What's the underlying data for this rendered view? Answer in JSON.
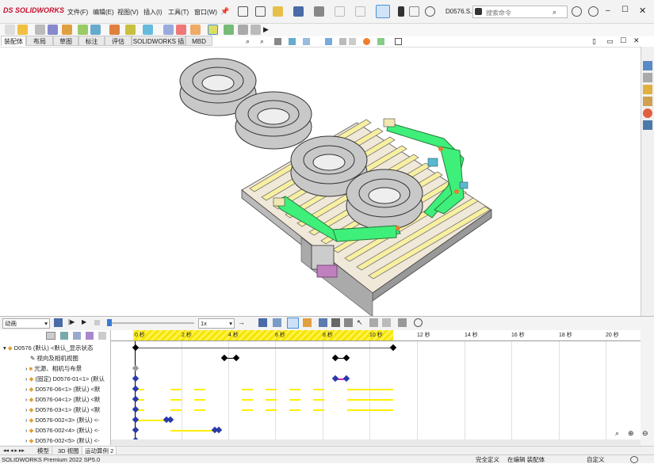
{
  "app": {
    "logo": "SOLIDWORKS",
    "doc_title": "D0576.S..."
  },
  "menu": [
    "文件(F)",
    "编辑(E)",
    "视图(V)",
    "插入(I)",
    "工具(T)",
    "窗口(W)"
  ],
  "search": {
    "placeholder": "搜索命令"
  },
  "tabs": [
    "装配体",
    "布局",
    "草图",
    "标注",
    "评估",
    "SOLIDWORKS 插件",
    "MBD"
  ],
  "motion": {
    "study_type": "动画",
    "speed": "1x",
    "time_labels": [
      "0 秒",
      "2 秒",
      "4 秒",
      "6 秒",
      "8 秒",
      "10 秒",
      "12 秒",
      "14 秒",
      "16 秒",
      "18 秒",
      "20 秒"
    ],
    "tree": [
      "D0576 (默认) <默认_显示状态",
      "视向及相机视图",
      "光源、相机与布景",
      "(固定) D0576-01<1> (默认",
      "D0576-06<1> (默认) <默",
      "D0576-04<1> (默认) <默",
      "D0576-03<1> (默认) <默",
      "D0576-002<3> (默认) <-",
      "D0576-002<4> (默认) <-",
      "D0576-002<5> (默认) <-"
    ]
  },
  "bottom_tabs": [
    "模型",
    "3D 视图",
    "运动算例 2"
  ],
  "status": {
    "version": "SOLIDWORKS Premium 2022 SP5.0",
    "defined": "完全定义",
    "editing": "在编辑 装配体",
    "custom": "自定义"
  },
  "colors": {
    "frame_green": "#3ef07a",
    "roller_yellow": "#f8f0a0",
    "tire_gray": "#c8c8c8",
    "key_yellow": "#ffef00",
    "brand_red": "#c8102e"
  }
}
